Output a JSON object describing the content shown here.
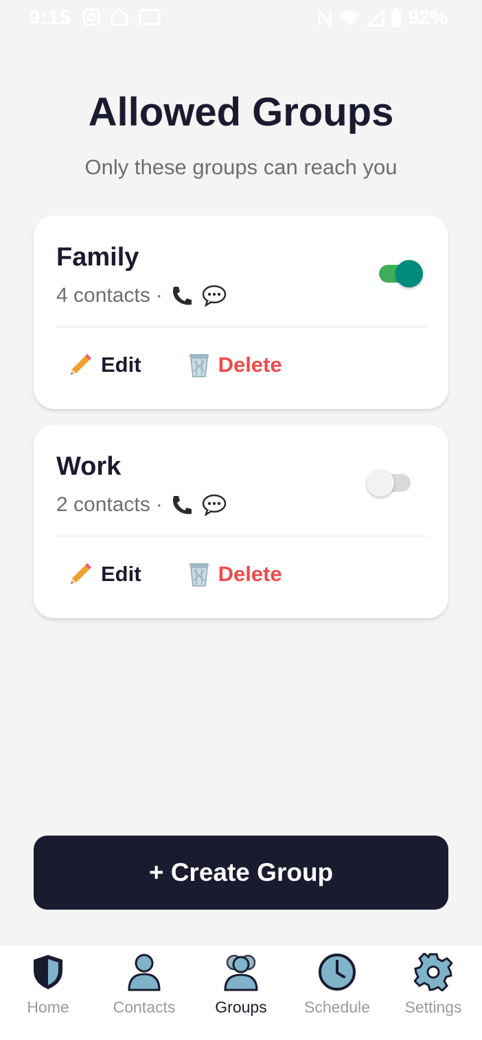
{
  "status_bar": {
    "time": "9:15",
    "battery": "92%",
    "icons": [
      "instagram-icon",
      "home-icon",
      "cast-icon",
      "nfc-icon",
      "wifi-icon",
      "signal-icon",
      "battery-icon"
    ]
  },
  "header": {
    "title": "Allowed Groups",
    "subtitle": "Only these groups can reach you"
  },
  "groups": [
    {
      "name": "Family",
      "contacts": "4 contacts",
      "separator": "·",
      "enabled": true,
      "edit_label": "Edit",
      "delete_label": "Delete"
    },
    {
      "name": "Work",
      "contacts": "2 contacts",
      "separator": "·",
      "enabled": false,
      "edit_label": "Edit",
      "delete_label": "Delete"
    }
  ],
  "create_button": {
    "label": "+ Create Group"
  },
  "nav": {
    "items": [
      {
        "label": "Home",
        "icon": "shield-icon",
        "active": false
      },
      {
        "label": "Contacts",
        "icon": "person-icon",
        "active": false
      },
      {
        "label": "Groups",
        "icon": "group-icon",
        "active": true
      },
      {
        "label": "Schedule",
        "icon": "clock-icon",
        "active": false
      },
      {
        "label": "Settings",
        "icon": "gear-icon",
        "active": false
      }
    ]
  },
  "colors": {
    "primary_dark": "#1b1b30",
    "background": "#f4f4f4",
    "delete_red": "#ee4b4b",
    "toggle_on_track": "#3fae5a",
    "toggle_on_knob": "#008a7a",
    "nav_icon_blue": "#7fb3c9"
  }
}
